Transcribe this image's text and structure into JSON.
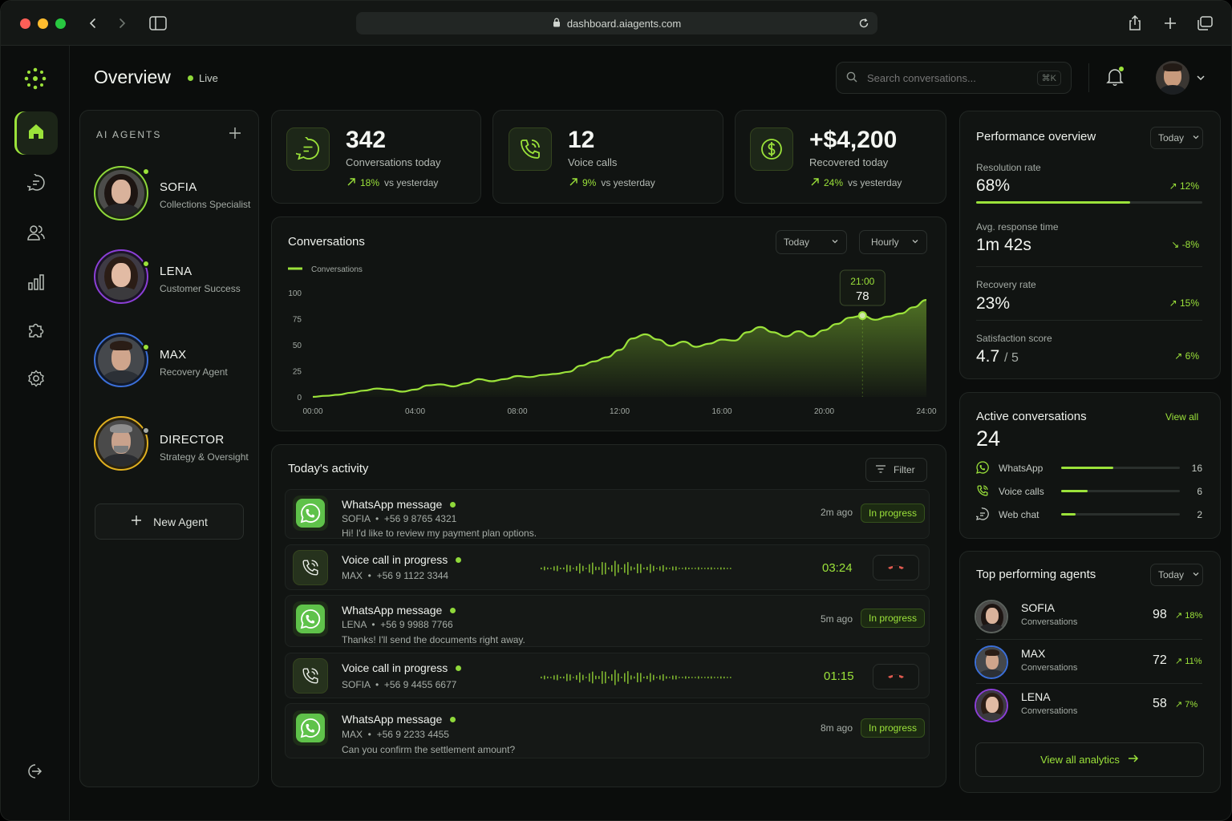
{
  "browser": {
    "url": "dashboard.aiagents.com"
  },
  "header": {
    "title": "Overview",
    "live": "Live",
    "search_placeholder": "Search conversations...",
    "search_shortcut": "⌘K"
  },
  "sidebar": {
    "items": [
      {
        "icon": "home-icon",
        "active": true
      },
      {
        "icon": "chat-icon"
      },
      {
        "icon": "users-icon"
      },
      {
        "icon": "bar-chart-icon"
      },
      {
        "icon": "puzzle-icon"
      },
      {
        "icon": "settings-icon"
      }
    ],
    "logout_icon": "logout-icon"
  },
  "agents_panel": {
    "title": "AI AGENTS",
    "agents": [
      {
        "name": "SOFIA",
        "role": "Collections Specialist",
        "ring": "#8fd83a"
      },
      {
        "name": "LENA",
        "role": "Customer Success",
        "ring": "#8b3fd6"
      },
      {
        "name": "MAX",
        "role": "Recovery Agent",
        "ring": "#3b6fd8"
      },
      {
        "name": "DIRECTOR",
        "role": "Strategy & Oversight",
        "ring": "#e0b020"
      }
    ],
    "new_agent": "New Agent"
  },
  "stats": [
    {
      "value": "342",
      "label": "Conversations today",
      "delta": "18%",
      "suffix": "vs yesterday"
    },
    {
      "value": "12",
      "label": "Voice calls",
      "delta": "9%",
      "suffix": "vs yesterday"
    },
    {
      "value": "+$4,200",
      "label": "Recovered today",
      "delta": "24%",
      "suffix": "vs yesterday"
    }
  ],
  "conversations_chart": {
    "title": "Conversations",
    "filter1": "Today",
    "filter2": "Hourly",
    "tooltip_time": "21:00",
    "tooltip_value": "78"
  },
  "chart_data": {
    "type": "area",
    "title": "Conversations",
    "series": [
      {
        "name": "Conversations",
        "color": "#9be23a"
      }
    ],
    "x_ticks": [
      "00:00",
      "04:00",
      "08:00",
      "12:00",
      "16:00",
      "20:00",
      "24:00"
    ],
    "y_ticks": [
      "100",
      "75",
      "50",
      "25",
      "0"
    ],
    "ylim": [
      0,
      100
    ],
    "xlim": [
      0,
      24
    ],
    "points": [
      [
        0,
        0
      ],
      [
        0.5,
        1
      ],
      [
        1,
        2
      ],
      [
        1.5,
        4
      ],
      [
        2,
        6
      ],
      [
        2.5,
        8
      ],
      [
        3,
        7
      ],
      [
        3.5,
        5
      ],
      [
        4,
        7
      ],
      [
        4.5,
        11
      ],
      [
        5,
        12
      ],
      [
        5.5,
        10
      ],
      [
        6,
        13
      ],
      [
        6.5,
        17
      ],
      [
        7,
        15
      ],
      [
        7.5,
        17
      ],
      [
        8,
        20
      ],
      [
        8.5,
        19
      ],
      [
        9,
        21
      ],
      [
        9.5,
        22
      ],
      [
        10,
        24
      ],
      [
        10.5,
        30
      ],
      [
        11,
        34
      ],
      [
        11.5,
        38
      ],
      [
        12,
        45
      ],
      [
        12.5,
        56
      ],
      [
        13,
        60
      ],
      [
        13.5,
        55
      ],
      [
        14,
        49
      ],
      [
        14.5,
        53
      ],
      [
        15,
        48
      ],
      [
        15.5,
        51
      ],
      [
        16,
        55
      ],
      [
        16.5,
        54
      ],
      [
        17,
        62
      ],
      [
        17.5,
        67
      ],
      [
        18,
        62
      ],
      [
        18.5,
        58
      ],
      [
        19,
        63
      ],
      [
        19.5,
        58
      ],
      [
        20,
        64
      ],
      [
        20.5,
        70
      ],
      [
        21,
        76
      ],
      [
        21.5,
        78
      ],
      [
        22,
        74
      ],
      [
        22.5,
        77
      ],
      [
        23,
        80
      ],
      [
        23.5,
        86
      ],
      [
        24,
        93
      ]
    ],
    "highlight": {
      "x": 21.5,
      "y": 78,
      "label": "21:00"
    }
  },
  "activity": {
    "title": "Today's activity",
    "filter": "Filter",
    "items": [
      {
        "type": "whatsapp",
        "title": "WhatsApp message",
        "agent": "SOFIA",
        "phone": "+56 9 8765 4321",
        "message": "Hi! I'd like to review my payment plan options.",
        "time": "2m ago",
        "status": "In progress"
      },
      {
        "type": "voice",
        "title": "Voice call in progress",
        "agent": "MAX",
        "phone": "+56 9 1122 3344",
        "timer": "03:24"
      },
      {
        "type": "whatsapp",
        "title": "WhatsApp message",
        "agent": "LENA",
        "phone": "+56 9 9988 7766",
        "message": "Thanks! I'll send the documents right away.",
        "time": "5m ago",
        "status": "In progress"
      },
      {
        "type": "voice",
        "title": "Voice call in progress",
        "agent": "SOFIA",
        "phone": "+56 9 4455 6677",
        "timer": "01:15"
      },
      {
        "type": "whatsapp",
        "title": "WhatsApp message",
        "agent": "MAX",
        "phone": "+56 9 2233 4455",
        "message": "Can you confirm the settlement amount?",
        "time": "8m ago",
        "status": "In progress"
      }
    ]
  },
  "performance": {
    "title": "Performance overview",
    "filter": "Today",
    "metrics": [
      {
        "label": "Resolution rate",
        "value": "68%",
        "delta": "12%",
        "dir": "up",
        "progress": 0.68
      },
      {
        "label": "Avg. response time",
        "value": "1m 42s",
        "delta": "-8%",
        "dir": "down"
      },
      {
        "label": "Recovery rate",
        "value": "23%",
        "delta": "15%",
        "dir": "up"
      },
      {
        "label": "Satisfaction score",
        "value": "4.7",
        "value_suffix": "/ 5",
        "delta": "6%",
        "dir": "up"
      }
    ]
  },
  "active_conversations": {
    "title": "Active conversations",
    "view_all": "View all",
    "total": "24",
    "channels": [
      {
        "name": "WhatsApp",
        "count": "16",
        "share": 0.44
      },
      {
        "name": "Voice calls",
        "count": "6",
        "share": 0.22
      },
      {
        "name": "Web chat",
        "count": "2",
        "share": 0.12
      }
    ]
  },
  "top_agents": {
    "title": "Top performing agents",
    "filter": "Today",
    "agents": [
      {
        "name": "SOFIA",
        "sub": "Conversations",
        "value": "98",
        "delta": "18%"
      },
      {
        "name": "MAX",
        "sub": "Conversations",
        "value": "72",
        "delta": "11%"
      },
      {
        "name": "LENA",
        "sub": "Conversations",
        "value": "58",
        "delta": "7%"
      }
    ],
    "view_all": "View all analytics"
  },
  "colors": {
    "accent": "#9be23a",
    "danger": "#e05a4f",
    "background": "#0b0d0c",
    "panel": "#111412"
  }
}
